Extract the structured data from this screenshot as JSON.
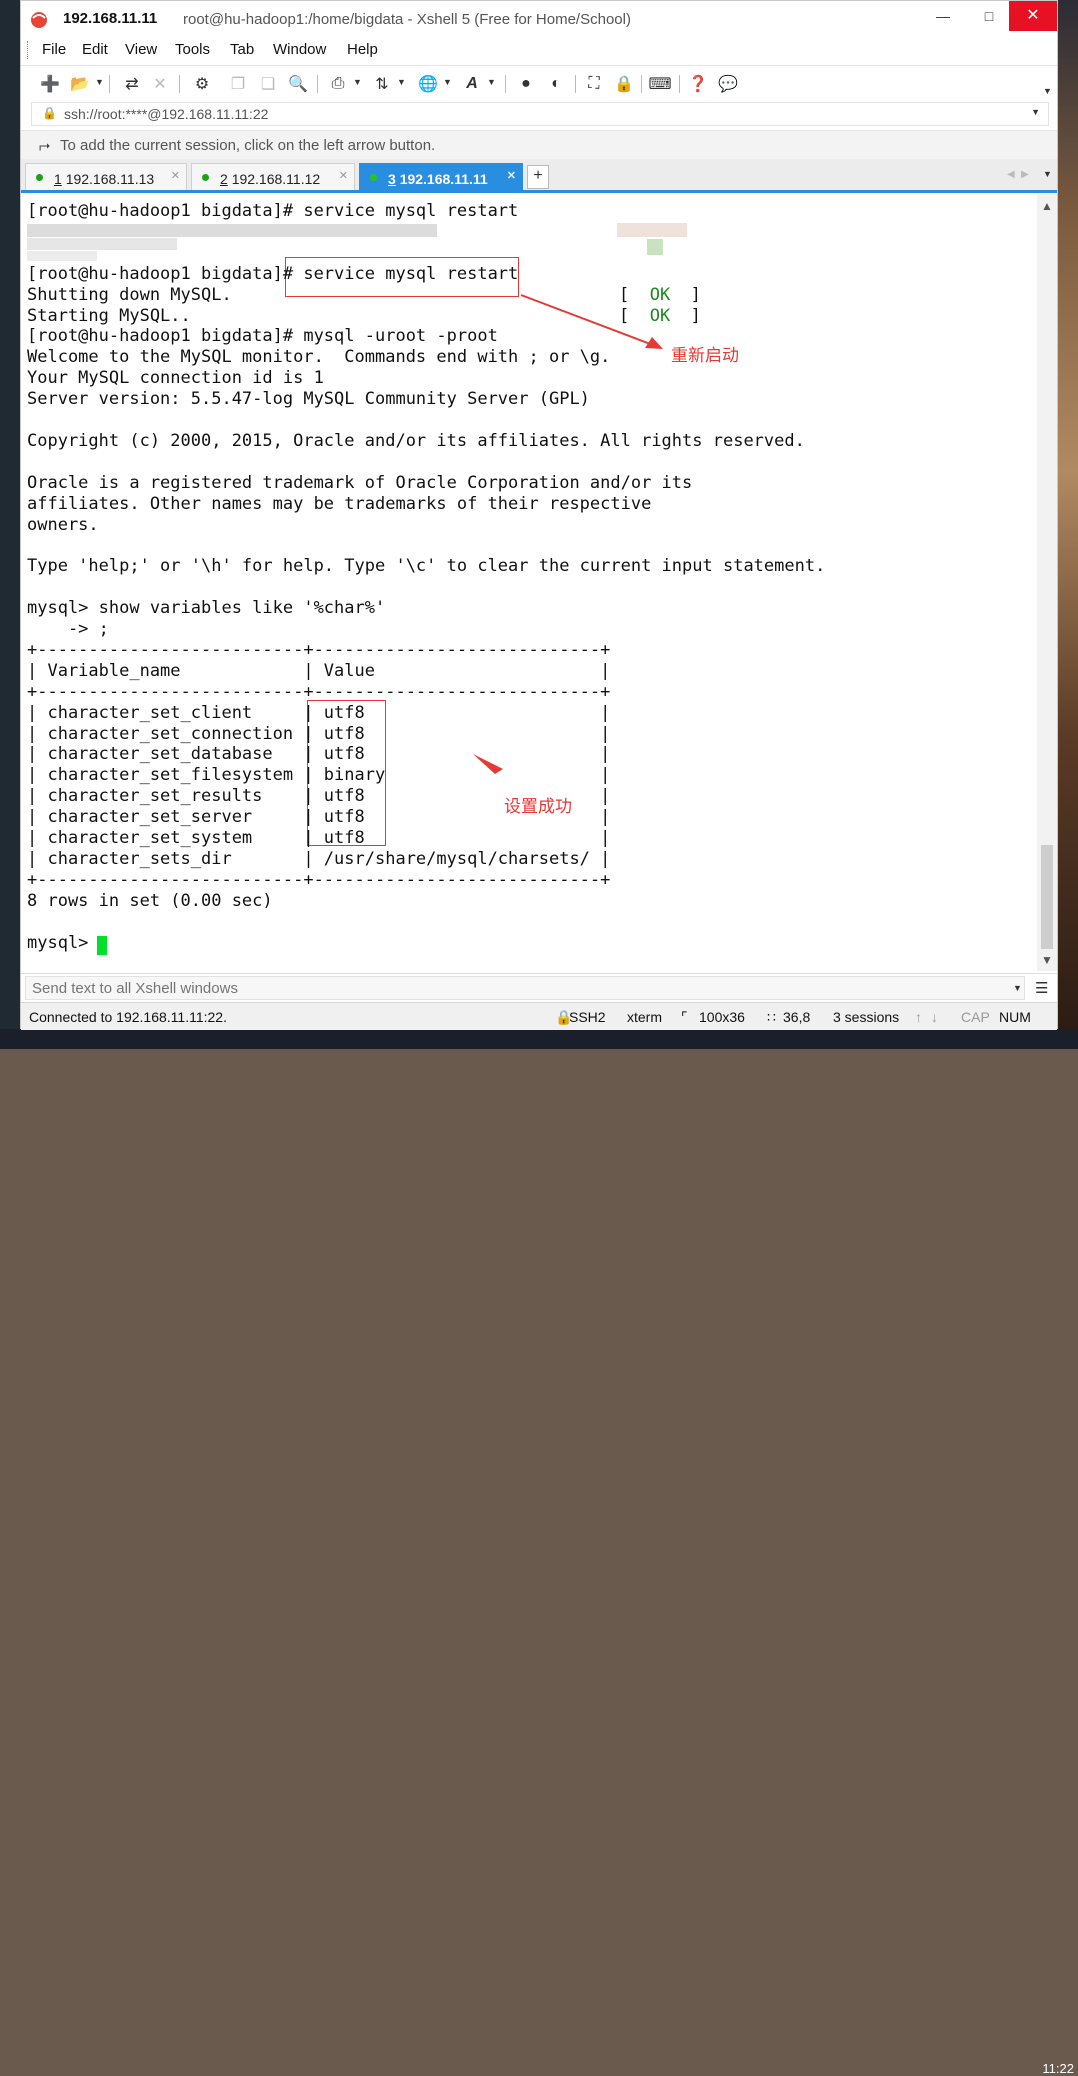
{
  "title": {
    "ip": "192.168.11.11",
    "rest": "root@hu-hadoop1:/home/bigdata - Xshell 5 (Free for Home/School)"
  },
  "window_controls": {
    "minimize": "—",
    "maximize": "□",
    "close": "✕"
  },
  "menu": [
    "File",
    "Edit",
    "View",
    "Tools",
    "Tab",
    "Window",
    "Help"
  ],
  "address": "ssh://root:****@192.168.11.11:22",
  "hint": "To add the current session, click on the left arrow button.",
  "tabs": [
    {
      "num": "1",
      "ip": "192.168.11.13"
    },
    {
      "num": "2",
      "ip": "192.168.11.12"
    },
    {
      "num": "3",
      "ip": "192.168.11.11",
      "active": true
    }
  ],
  "terminal": {
    "lines": [
      "[root@hu-hadoop1 bigdata]# service mysql restart",
      "",
      "",
      "[root@hu-hadoop1 bigdata]# service mysql restart",
      "Shutting down MySQL.",
      "Starting MySQL..",
      "[root@hu-hadoop1 bigdata]# mysql -uroot -proot",
      "Welcome to the MySQL monitor.  Commands end with ; or \\g.",
      "Your MySQL connection id is 1",
      "Server version: 5.5.47-log MySQL Community Server (GPL)",
      "",
      "Copyright (c) 2000, 2015, Oracle and/or its affiliates. All rights reserved.",
      "",
      "Oracle is a registered trademark of Oracle Corporation and/or its",
      "affiliates. Other names may be trademarks of their respective",
      "owners.",
      "",
      "Type 'help;' or '\\h' for help. Type '\\c' to clear the current input statement.",
      "",
      "mysql> show variables like '%char%'",
      "    -> ;",
      "+--------------------------+----------------------------+",
      "| Variable_name            | Value                      |",
      "+--------------------------+----------------------------+",
      "| character_set_client     | utf8                       |",
      "| character_set_connection | utf8                       |",
      "| character_set_database   | utf8                       |",
      "| character_set_filesystem | binary                     |",
      "| character_set_results    | utf8                       |",
      "| character_set_server     | utf8                       |",
      "| character_set_system     | utf8                       |",
      "| character_sets_dir       | /usr/share/mysql/charsets/ |",
      "+--------------------------+----------------------------+",
      "8 rows in set (0.00 sec)",
      "",
      "mysql> "
    ],
    "ok_left": "[  ",
    "ok_word": "OK",
    "ok_right": "  ]"
  },
  "annotations": {
    "restart": "重新启动",
    "success": "设置成功",
    "color": "#e53935"
  },
  "send_placeholder": "Send text to all Xshell windows",
  "status": {
    "connected": "Connected to 192.168.11.11:22.",
    "protocol": "SSH2",
    "term": "xterm",
    "size": "100x36",
    "pos": "36,8",
    "sessions": "3 sessions",
    "cap": "CAP",
    "num": "NUM"
  },
  "clock": "11:22",
  "colors": {
    "accent": "#2a8ee0",
    "close": "#e81123",
    "cursor": "#00e02a",
    "ok": "#1b8a1b"
  }
}
